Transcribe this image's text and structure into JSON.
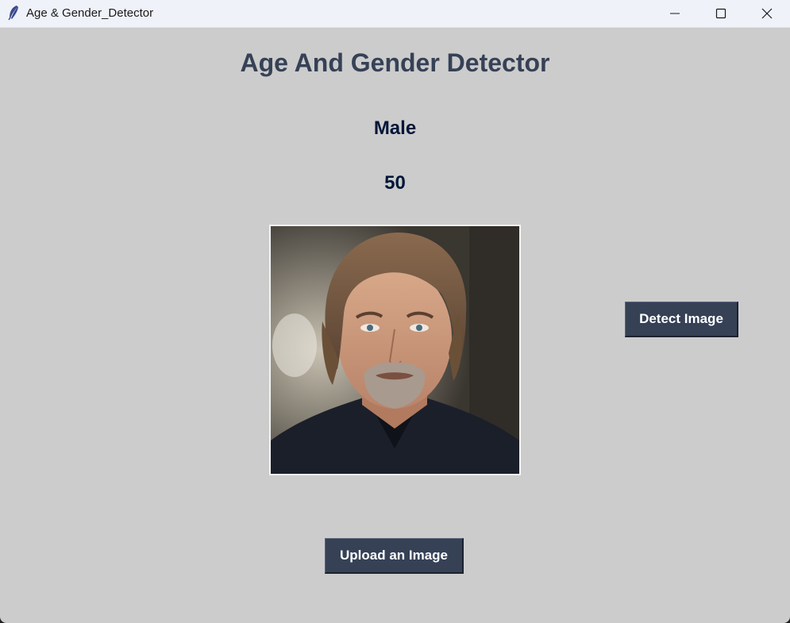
{
  "window": {
    "title": "Age & Gender_Detector",
    "icon": "feather-icon",
    "controls": {
      "minimize": "minimize-icon",
      "maximize": "maximize-icon",
      "close": "close-icon"
    }
  },
  "main": {
    "heading": "Age And Gender Detector",
    "gender": "Male",
    "age": "50",
    "image": "portrait-photo"
  },
  "buttons": {
    "detect_label": "Detect Image",
    "upload_label": "Upload an Image"
  },
  "colors": {
    "background": "#cccccc",
    "heading": "#364156",
    "result_text": "#011638",
    "button_bg": "#364156",
    "button_text": "#ffffff"
  }
}
